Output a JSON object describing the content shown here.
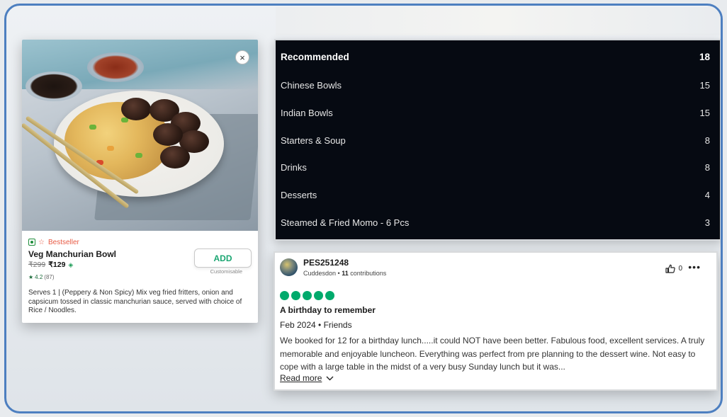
{
  "product": {
    "badge": "Bestseller",
    "name": "Veg Manchurian Bowl",
    "old_price": "₹299",
    "price": "₹129",
    "rating": "4.2",
    "rating_count": "(87)",
    "add_label": "ADD",
    "customisable": "Customisable",
    "description": "Serves 1 | (Peppery & Non Spicy) Mix veg fried fritters, onion and capsicum tossed in classic manchurian sauce, served with choice of Rice / Noodles.",
    "close_symbol": "×"
  },
  "categories": {
    "header": {
      "label": "Recommended",
      "count": "18"
    },
    "items": [
      {
        "label": "Chinese Bowls",
        "count": "15"
      },
      {
        "label": "Indian Bowls",
        "count": "15"
      },
      {
        "label": "Starters & Soup",
        "count": "8"
      },
      {
        "label": "Drinks",
        "count": "8"
      },
      {
        "label": "Desserts",
        "count": "4"
      },
      {
        "label": "Steamed & Fried Momo - 6 Pcs",
        "count": "3"
      }
    ]
  },
  "review": {
    "username": "PES251248",
    "location": "Cuddesdon",
    "contributions_count": "11",
    "contributions_label": "contributions",
    "helpful_count": "0",
    "rating_bubbles": 5,
    "title": "A birthday to remember",
    "date_type": "Feb 2024 • Friends",
    "text": "We booked for 12 for a birthday lunch.....it could NOT have been better. Fabulous food, excellent services. A truly memorable and enjoyable luncheon. Everything was perfect from pre planning to the dessert wine. Not easy to cope with a large table in the midst of a very busy Sunday lunch but it was...",
    "read_more": "Read more"
  },
  "colors": {
    "frame_border": "#4d7fc0",
    "panel_bg": "#060a12",
    "add_green": "#1ba672",
    "bubble_green": "#00aa6c",
    "bestseller_red": "#e85a44"
  }
}
